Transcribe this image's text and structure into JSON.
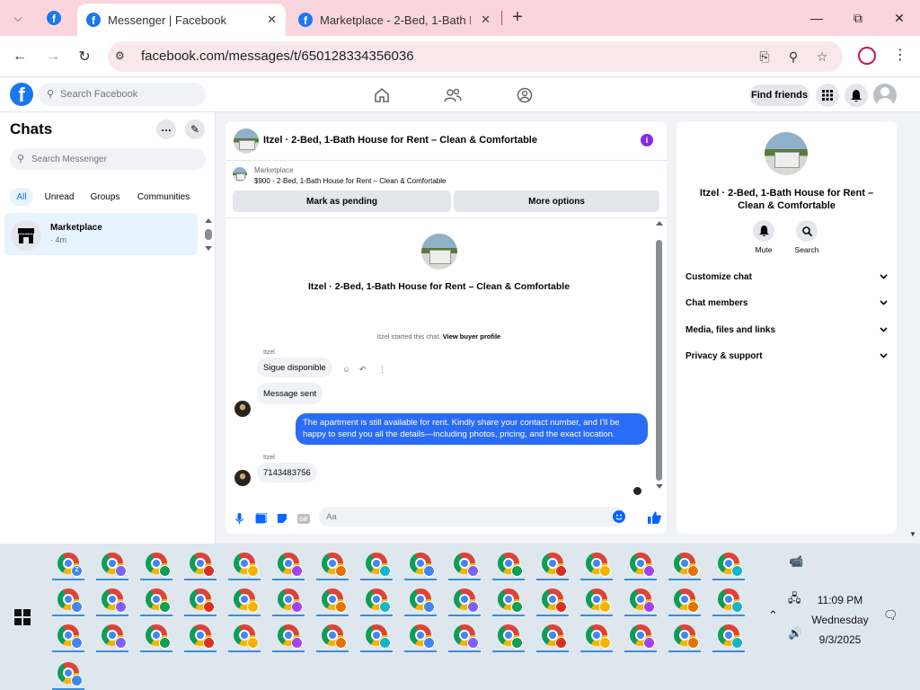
{
  "browser": {
    "tabs": [
      {
        "title": "Messenger | Facebook",
        "active": true
      },
      {
        "title": "Marketplace - 2-Bed, 1-Bath Ho",
        "active": false
      }
    ],
    "url": "facebook.com/messages/t/650128334356036",
    "accent": "#fbd5dd"
  },
  "fb": {
    "search_placeholder": "Search Facebook",
    "find_friends": "Find friends",
    "brand_color": "#1877f2"
  },
  "chats": {
    "title": "Chats",
    "search_placeholder": "Search Messenger",
    "filters": [
      "All",
      "Unread",
      "Groups",
      "Communities"
    ],
    "items": [
      {
        "name": "Marketplace",
        "time": "· 4m"
      }
    ]
  },
  "conversation": {
    "title": "Itzel · 2-Bed, 1-Bath House for Rent – Clean & Comfortable",
    "marketplace_label": "Marketplace",
    "listing_price": "$900 - 2-Bed, 1-Bath House for Rent – Clean & Comfortable",
    "mark_pending": "Mark as pending",
    "more_options": "More options",
    "thread_title": "Itzel · 2-Bed, 1-Bath House for Rent – Clean & Comfortable",
    "started_text": "Itzel started this chat.",
    "buyer_profile_link": "View buyer profile",
    "messages": [
      {
        "sender": "Itzel",
        "text": "Sigue disponible"
      },
      {
        "text": "Message sent"
      },
      {
        "outgoing": true,
        "text": "The apartment is still available for rent. Kindly share your contact number, and I'll be happy to send you all the details—including photos, pricing, and the exact location."
      },
      {
        "sender": "Itzel",
        "text": "7143483756"
      }
    ],
    "composer_placeholder": "Aa",
    "outgoing_color": "#2a6cf6"
  },
  "right_panel": {
    "title": "Itzel · 2-Bed, 1-Bath House for Rent – Clean & Comfortable",
    "actions": [
      "Mute",
      "Search"
    ],
    "sections": [
      "Customize chat",
      "Chat members",
      "Media, files and links",
      "Privacy & support"
    ]
  },
  "taskbar": {
    "time": "11:09 PM",
    "day": "Wednesday",
    "date": "9/3/2025",
    "first_badge_letter": "Z"
  }
}
